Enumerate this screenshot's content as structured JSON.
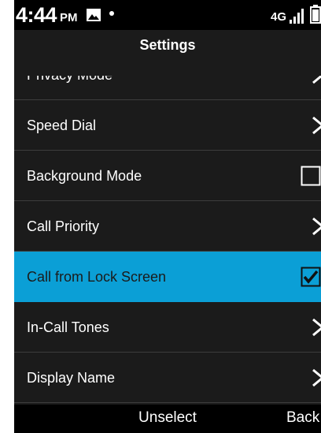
{
  "status_bar": {
    "time": "4:44",
    "ampm": "PM",
    "network": "4G",
    "icons": [
      "gallery-icon",
      "notification-dot-icon",
      "signal-icon",
      "battery-icon"
    ]
  },
  "header": {
    "title": "Settings"
  },
  "list": {
    "items": [
      {
        "label": "Privacy Mode",
        "control": "chevron",
        "selected": false
      },
      {
        "label": "Speed Dial",
        "control": "chevron",
        "selected": false
      },
      {
        "label": "Background Mode",
        "control": "checkbox",
        "checked": false,
        "selected": false
      },
      {
        "label": "Call Priority",
        "control": "chevron",
        "selected": false
      },
      {
        "label": "Call from Lock Screen",
        "control": "checkbox",
        "checked": true,
        "selected": true
      },
      {
        "label": "In-Call Tones",
        "control": "chevron",
        "selected": false
      },
      {
        "label": "Display Name",
        "control": "chevron",
        "selected": false
      }
    ]
  },
  "softkeys": {
    "left": "",
    "center": "Unselect",
    "right": "Back"
  },
  "colors": {
    "background": "#1b1b1b",
    "status_bar": "#000000",
    "selected": "#0b9fd6",
    "divider": "#3d3d3d",
    "text": "#ffffff"
  }
}
